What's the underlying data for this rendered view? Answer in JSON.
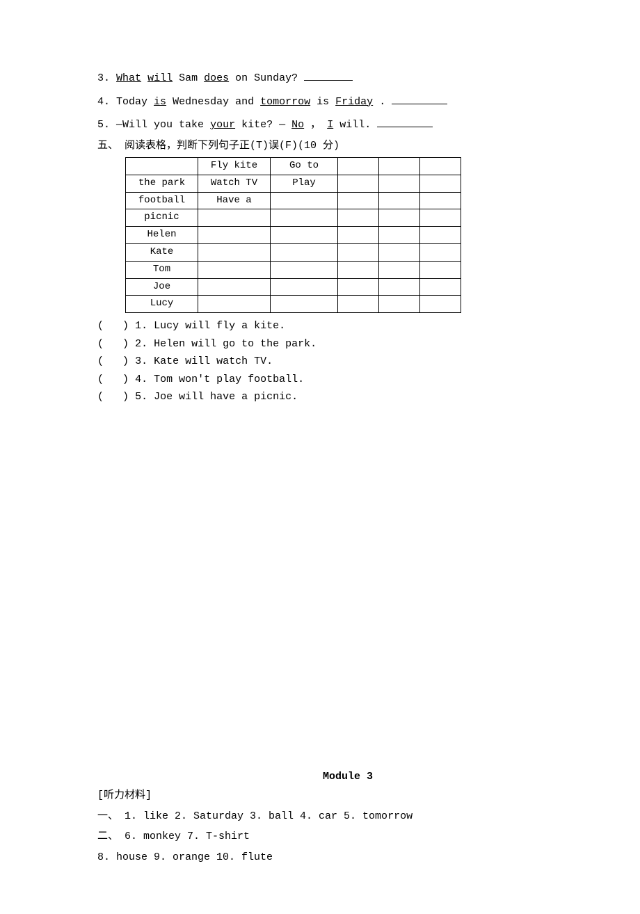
{
  "questions": {
    "q3": {
      "num": "3.",
      "p1": "What",
      "p2": "will",
      "p3": " Sam ",
      "p4": "does",
      "p5": " on Sunday? "
    },
    "q4": {
      "num": "4.",
      "p1": " Today ",
      "p2": "is",
      "p3": " Wednesday and ",
      "p4": "tomorrow",
      "p5": " is ",
      "p6": "Friday",
      "p7": "."
    },
    "q5": {
      "num": "5.",
      "p1": " —Will you take ",
      "p2": "your",
      "p3": " kite? —",
      "p4": "No",
      "p5": "，",
      "p6": "I",
      "p7": " will."
    }
  },
  "section5": {
    "heading": "五、 阅读表格，判断下列句子正(T)误(F)(10 分)"
  },
  "table": {
    "rows": [
      [
        "",
        "Fly kite",
        "Go to",
        "",
        "",
        ""
      ],
      [
        "the park",
        "Watch TV",
        "Play",
        "",
        "",
        ""
      ],
      [
        "football",
        "Have a",
        "",
        "",
        "",
        ""
      ],
      [
        "picnic",
        "",
        "",
        "",
        "",
        ""
      ],
      [
        "Helen",
        "",
        "",
        "",
        "",
        ""
      ],
      [
        "Kate",
        "",
        "",
        "",
        "",
        ""
      ],
      [
        "Tom",
        "",
        "",
        "",
        "",
        ""
      ],
      [
        "Joe",
        "",
        "",
        "",
        "",
        ""
      ],
      [
        "Lucy",
        "",
        "",
        "",
        "",
        ""
      ]
    ]
  },
  "tf": {
    "paren_open": "(",
    "paren_close": ")",
    "items": [
      "1. Lucy will fly a kite.",
      "2. Helen will go to the park.",
      "3. Kate will watch TV.",
      "4. Tom won't play football.",
      "5. Joe will have a picnic."
    ]
  },
  "module": {
    "title": "Module 3"
  },
  "answers": {
    "label": "[听力材料]",
    "line1": "一、 1. like  2. Saturday  3. ball  4. car  5. tomorrow",
    "line2": "二、 6. monkey  7. T-shirt",
    "line3": "8. house  9. orange  10. flute"
  }
}
